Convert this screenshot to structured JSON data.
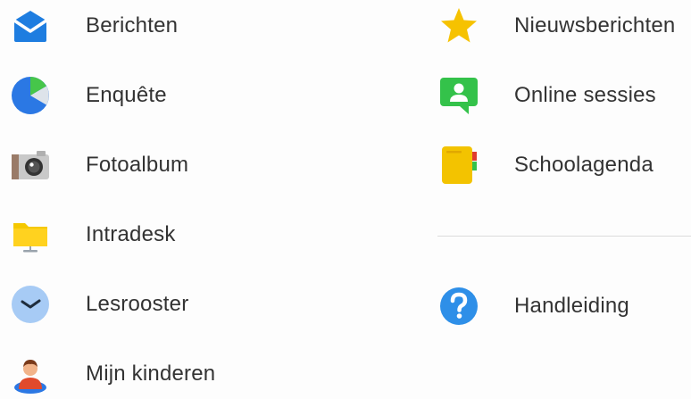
{
  "left_column": {
    "items": [
      {
        "label": "Berichten",
        "icon": "envelope-icon"
      },
      {
        "label": "Enquête",
        "icon": "pie-chart-icon"
      },
      {
        "label": "Fotoalbum",
        "icon": "camera-icon"
      },
      {
        "label": "Intradesk",
        "icon": "folder-icon"
      },
      {
        "label": "Lesrooster",
        "icon": "clock-icon"
      },
      {
        "label": "Mijn kinderen",
        "icon": "child-icon"
      }
    ]
  },
  "right_column": {
    "items": [
      {
        "label": "Nieuwsberichten",
        "icon": "star-icon"
      },
      {
        "label": "Online sessies",
        "icon": "chat-person-icon"
      },
      {
        "label": "Schoolagenda",
        "icon": "agenda-book-icon"
      }
    ],
    "help": {
      "label": "Handleiding",
      "icon": "question-icon"
    }
  },
  "colors": {
    "text": "#333333",
    "envelope": "#1e7de0",
    "pie_main": "#2b78e4",
    "pie_accent": "#46c64a",
    "star": "#f6c200",
    "chat": "#34c24a",
    "agenda": "#f3c300",
    "question": "#2e8fe8",
    "folder": "#f5c800",
    "clock_face": "#a7cbf5"
  }
}
